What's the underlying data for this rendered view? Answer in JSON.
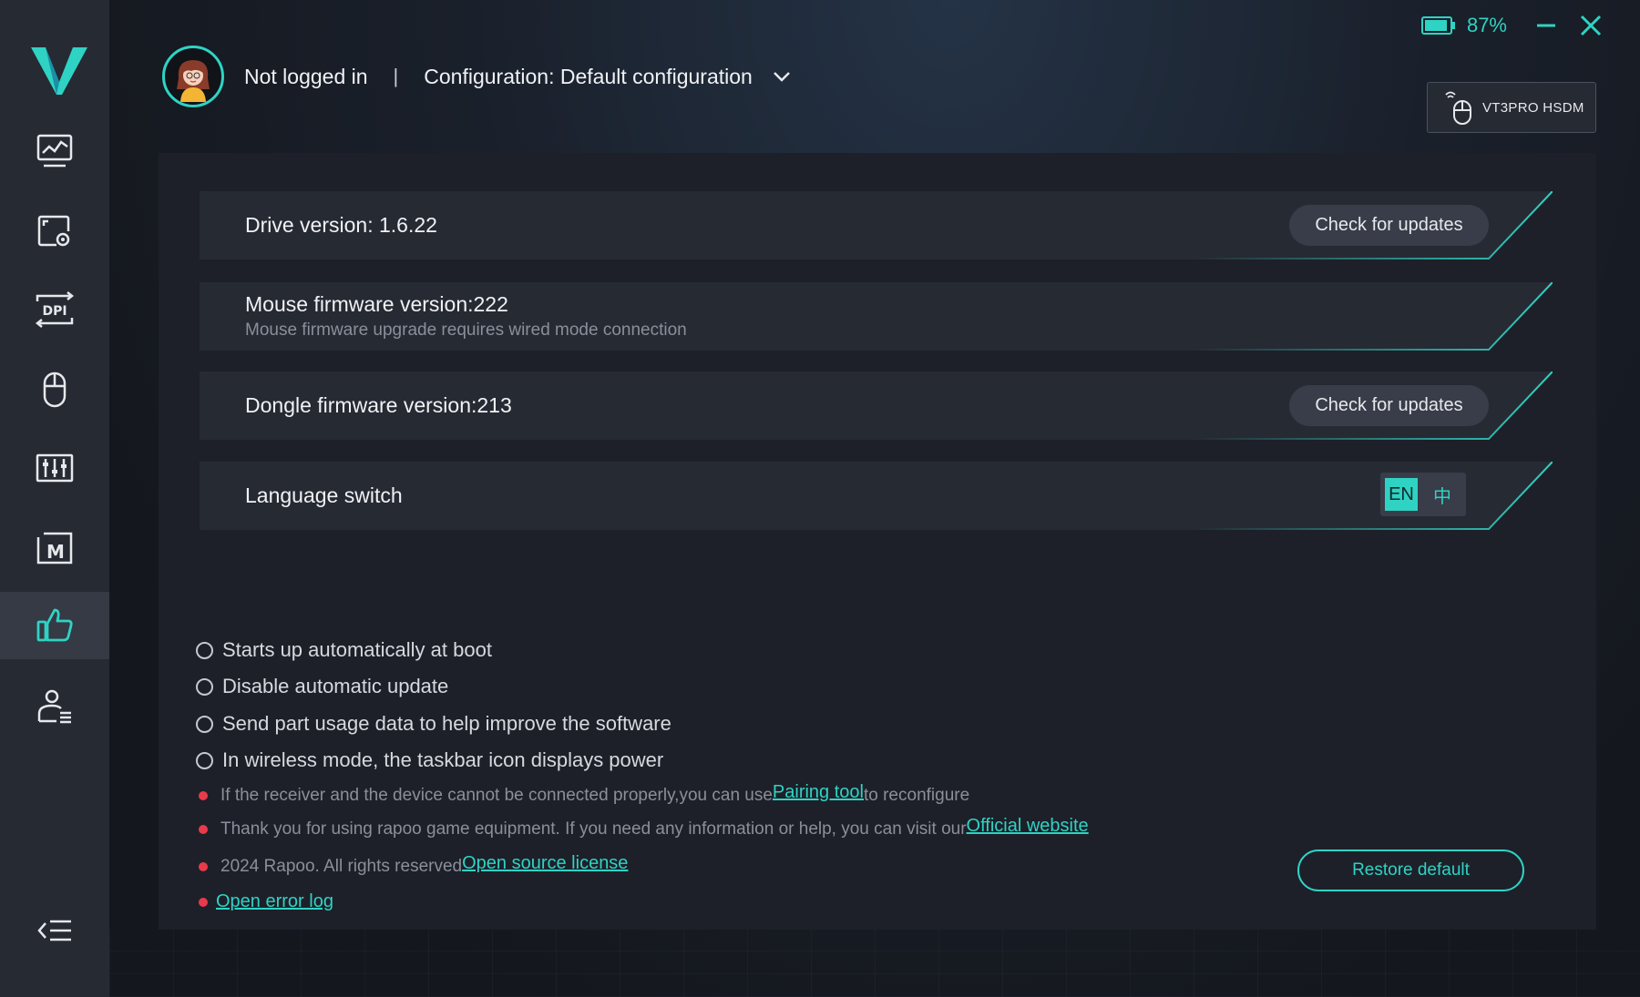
{
  "header": {
    "login_status": "Not logged in",
    "separator": "|",
    "configuration": "Configuration: Default configuration"
  },
  "status": {
    "battery_percent": "87%",
    "battery_level": 0.87
  },
  "device": {
    "name": "VT3PRO HSDM"
  },
  "sidebar": {
    "items": [
      {
        "icon": "performance-chart-icon"
      },
      {
        "icon": "screen-settings-icon"
      },
      {
        "icon": "dpi-icon",
        "label": "DPI"
      },
      {
        "icon": "mouse-icon"
      },
      {
        "icon": "equalizer-icon"
      },
      {
        "icon": "macro-icon",
        "label": "M"
      },
      {
        "icon": "thumbs-up-icon",
        "active": true
      },
      {
        "icon": "user-list-icon"
      }
    ],
    "collapse_icon": "collapse-menu-icon"
  },
  "versions": {
    "drive": "Drive version: 1.6.22",
    "mouse_fw": "Mouse firmware version:222",
    "mouse_fw_note": "Mouse firmware upgrade requires wired mode connection",
    "dongle_fw": "Dongle firmware version:213",
    "check_updates": "Check for updates"
  },
  "language": {
    "title": "Language switch",
    "en": "EN",
    "zh": "中",
    "selected": "EN"
  },
  "options": [
    "Starts up automatically at boot",
    "Disable automatic update",
    "Send part usage data to help improve the software",
    "In wireless mode, the taskbar icon displays power"
  ],
  "notes": {
    "pairing_prefix": "If the receiver and the device cannot be connected properly,you can use",
    "pairing_link": "Pairing tool",
    "pairing_suffix": "to reconfigure",
    "thanks_prefix": "Thank you for using rapoo game equipment. If you need any information or help, you can visit our",
    "website_link": "Official website",
    "copyright": "2024 Rapoo. All rights reserved",
    "license_link": "Open source license",
    "error_log_link": "Open error log"
  },
  "restore_default": "Restore default",
  "colors": {
    "accent": "#2fd3c4",
    "sidebar": "#262a33",
    "row": "#262a33",
    "dot": "#e83a4c"
  }
}
